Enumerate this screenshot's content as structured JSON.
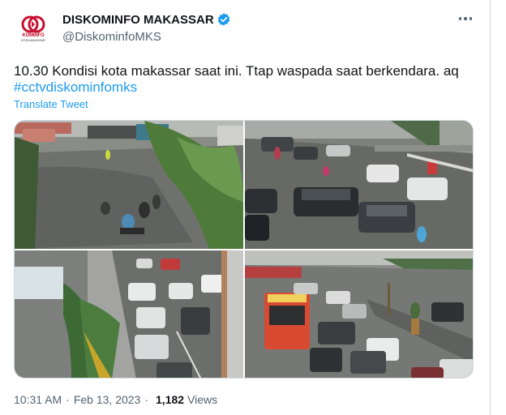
{
  "author": {
    "avatar_text": "KOMINFO",
    "avatar_subtext": "KOTA MAKASSAR",
    "display_name": "DISKOMINFO MAKASSAR",
    "handle": "@DiskominfoMKS",
    "verified": true,
    "verified_color": "#1d9bf0",
    "brand_color": "#c8102e"
  },
  "tweet": {
    "text": "10.30 Kondisi kota makassar saat ini. Ttap waspada saat berkendara. aq",
    "hashtag": "#cctvdiskominfomks",
    "translate_label": "Translate Tweet",
    "time": "10:31 AM",
    "date": "Feb 13, 2023",
    "separator": "·",
    "views_count": "1,182",
    "views_label": "Views"
  },
  "media": {
    "photos": [
      "flooded-street-motorcyclists",
      "flooded-road-cars",
      "traffic-jam-rain",
      "flooded-intersection-traffic"
    ]
  },
  "colors": {
    "link": "#1d9bf0",
    "secondary_text": "#536471",
    "primary_text": "#0f1419",
    "border": "#cfd9de"
  }
}
